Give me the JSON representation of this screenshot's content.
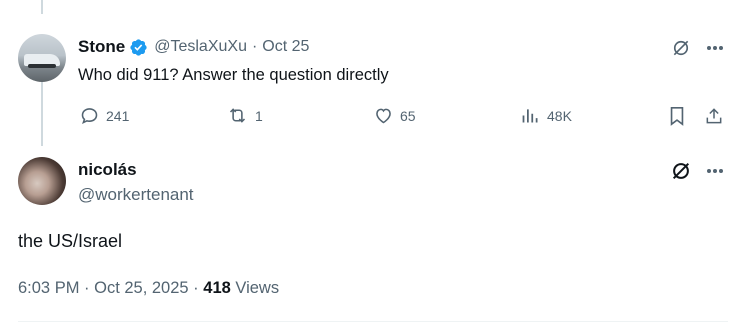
{
  "parent_tweet": {
    "author_name": "Stone",
    "handle": "@TeslaXuXu",
    "separator": "·",
    "date": "Oct 25",
    "text": "Who did 911? Answer the question directly",
    "replies": "241",
    "reposts": "1",
    "likes": "65",
    "views": "48K"
  },
  "reply_tweet": {
    "author_name": "nicolás",
    "handle": "@workertenant",
    "text": "the US/Israel",
    "timestamp": "6:03 PM · Oct 25, 2025",
    "footer_separator": " · ",
    "views_count": "418",
    "views_label": " Views"
  },
  "colors": {
    "verified": "#1d9bf0",
    "muted": "#536471",
    "text": "#0f1419"
  }
}
